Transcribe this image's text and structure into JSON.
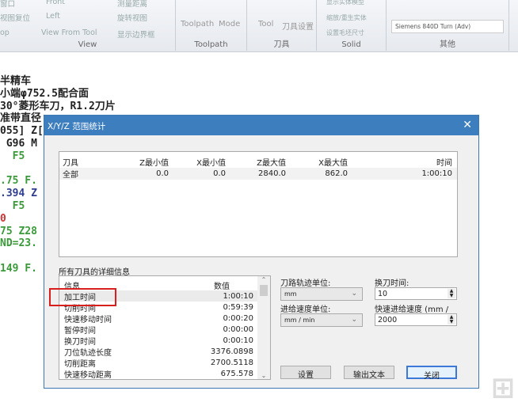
{
  "ribbon": {
    "view_items": [
      "窗口",
      "视图复位",
      "op",
      "Front",
      "Left",
      "View From Tool",
      "测量距离",
      "旋转视图",
      "显示边界框"
    ],
    "toolpath_items": [
      "Toolpath",
      "Mode"
    ],
    "tool_items": [
      "Tool",
      "刀具设置"
    ],
    "solid_items": [
      "显示实体模型",
      "缩放/重生实体",
      "设置毛坯尺寸"
    ],
    "controller": "Siemens 840D Turn (Adv)",
    "groups": [
      "View",
      "Toolpath",
      "刀具",
      "Solid",
      "其他"
    ]
  },
  "code": [
    {
      "t": "半精车",
      "c": "k"
    },
    {
      "t": "小端φ752.5配合面",
      "c": "k"
    },
    {
      "t": "30°菱形车刀，R1.2刀片",
      "c": "k"
    },
    {
      "t": "准带直径",
      "c": "k"
    },
    {
      "t": "055] Z[",
      "c": "k"
    },
    {
      "t": " G96 M",
      "c": "k"
    },
    {
      "t": "  F5",
      "c": "g"
    },
    {
      "t": "",
      "c": "k"
    },
    {
      "t": ".75 F.",
      "c": "g"
    },
    {
      "t": ".394 Z",
      "c": "b"
    },
    {
      "t": "  F5",
      "c": "g"
    },
    {
      "t": "0",
      "c": "r"
    },
    {
      "t": "75 Z28",
      "c": "g"
    },
    {
      "t": "ND=23.",
      "c": "g"
    },
    {
      "t": "",
      "c": "k"
    },
    {
      "t": "149 F.",
      "c": "g"
    }
  ],
  "dialog": {
    "title": "X/Y/Z 范围统计",
    "close": "✕",
    "table": {
      "headers": [
        "刀具",
        "Z最小值",
        "X最小值",
        "Z最大值",
        "X最大值",
        "时间"
      ],
      "rows": [
        [
          "全部",
          "0.0",
          "0.0",
          "2840.0",
          "862.0",
          "1:00:10"
        ]
      ]
    },
    "details_label": "所有刀具的详细信息",
    "details": {
      "headers": [
        "信息",
        "数值"
      ],
      "rows": [
        [
          "加工时间",
          "1:00:10"
        ],
        [
          "切削时间",
          "0:59:39"
        ],
        [
          "快速移动时间",
          "0:00:20"
        ],
        [
          "暂停时间",
          "0:00:00"
        ],
        [
          "换刀时间",
          "0:00:10"
        ],
        [
          "刀位轨迹长度",
          "3376.0898"
        ],
        [
          "切削距离",
          "2700.5118"
        ],
        [
          "快速移动距离",
          "675.578"
        ]
      ]
    },
    "path_unit_label": "刀路轨迹单位:",
    "path_unit": "mm",
    "feed_unit_label": "进给速度单位:",
    "feed_unit": "mm / min",
    "tool_change_label": "换刀时间:",
    "tool_change": "10",
    "rapid_label": "快速进给速度 (mm /",
    "rapid": "2000",
    "buttons": [
      "设置",
      "输出文本",
      "关闭"
    ]
  }
}
